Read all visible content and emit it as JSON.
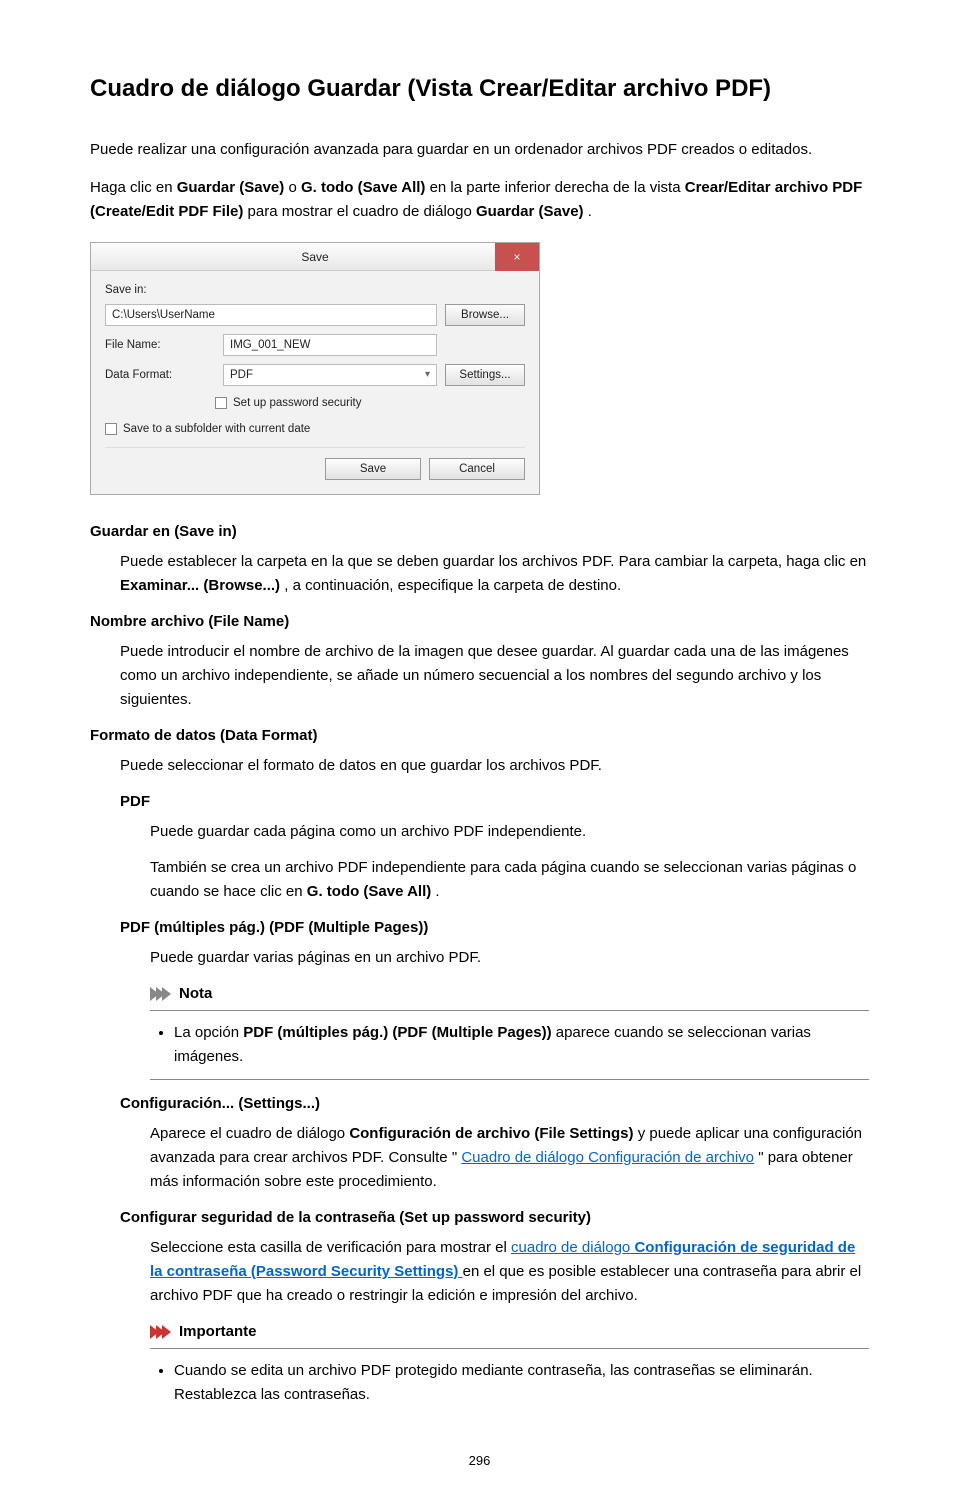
{
  "page": {
    "title": "Cuadro de diálogo Guardar (Vista Crear/Editar archivo PDF)",
    "intro": "Puede realizar una configuración avanzada para guardar en un ordenador archivos PDF creados o editados.",
    "intro2_pre": "Haga clic en ",
    "intro2_b1": "Guardar (Save)",
    "intro2_mid1": " o ",
    "intro2_b2": "G. todo (Save All)",
    "intro2_mid2": " en la parte inferior derecha de la vista ",
    "intro2_b3": "Crear/Editar archivo PDF (Create/Edit PDF File)",
    "intro2_mid3": " para mostrar el cuadro de diálogo ",
    "intro2_b4": "Guardar (Save)",
    "intro2_end": ".",
    "pagenum": "296"
  },
  "dialog": {
    "title": "Save",
    "save_in_label": "Save in:",
    "save_in_value": "C:\\Users\\UserName",
    "browse": "Browse...",
    "file_name_label": "File Name:",
    "file_name_value": "IMG_001_NEW",
    "data_format_label": "Data Format:",
    "data_format_value": "PDF",
    "settings": "Settings...",
    "pw_security": "Set up password security",
    "subfolder": "Save to a subfolder with current date",
    "save_btn": "Save",
    "cancel_btn": "Cancel"
  },
  "sections": {
    "save_in_dt": "Guardar en (Save in)",
    "save_in_dd_pre": "Puede establecer la carpeta en la que se deben guardar los archivos PDF. Para cambiar la carpeta, haga clic en ",
    "save_in_dd_b": "Examinar... (Browse...)",
    "save_in_dd_post": ", a continuación, especifique la carpeta de destino.",
    "file_name_dt": "Nombre archivo (File Name)",
    "file_name_dd": "Puede introducir el nombre de archivo de la imagen que desee guardar. Al guardar cada una de las imágenes como un archivo independiente, se añade un número secuencial a los nombres del segundo archivo y los siguientes.",
    "data_format_dt": "Formato de datos (Data Format)",
    "data_format_dd": "Puede seleccionar el formato de datos en que guardar los archivos PDF.",
    "pdf_dt": "PDF",
    "pdf_dd1": "Puede guardar cada página como un archivo PDF independiente.",
    "pdf_dd2_pre": "También se crea un archivo PDF independiente para cada página cuando se seleccionan varias páginas o cuando se hace clic en ",
    "pdf_dd2_b": "G. todo (Save All)",
    "pdf_dd2_post": ".",
    "pdfmulti_dt": "PDF (múltiples pág.) (PDF (Multiple Pages))",
    "pdfmulti_dd": "Puede guardar varias páginas en un archivo PDF.",
    "nota_title": "Nota",
    "nota_item_pre": "La opción ",
    "nota_item_b": "PDF (múltiples pág.) (PDF (Multiple Pages))",
    "nota_item_post": " aparece cuando se seleccionan varias imágenes.",
    "settings_dt": "Configuración... (Settings...)",
    "settings_dd_pre": "Aparece el cuadro de diálogo ",
    "settings_dd_b": "Configuración de archivo (File Settings)",
    "settings_dd_mid": " y puede aplicar una configuración avanzada para crear archivos PDF. Consulte \"",
    "settings_dd_link": "Cuadro de diálogo Configuración de archivo",
    "settings_dd_post": "\" para obtener más información sobre este procedimiento.",
    "pw_dt": "Configurar seguridad de la contraseña (Set up password security)",
    "pw_dd_pre": "Seleccione esta casilla de verificación para mostrar el ",
    "pw_dd_link_pre": "cuadro de diálogo ",
    "pw_dd_link_b": "Configuración de seguridad de la contraseña (Password Security Settings)",
    "pw_dd_post": " en el que es posible establecer una contraseña para abrir el archivo PDF que ha creado o restringir la edición e impresión del archivo.",
    "imp_title": "Importante",
    "imp_item": "Cuando se edita un archivo PDF protegido mediante contraseña, las contraseñas se eliminarán. Restablezca las contraseñas."
  }
}
